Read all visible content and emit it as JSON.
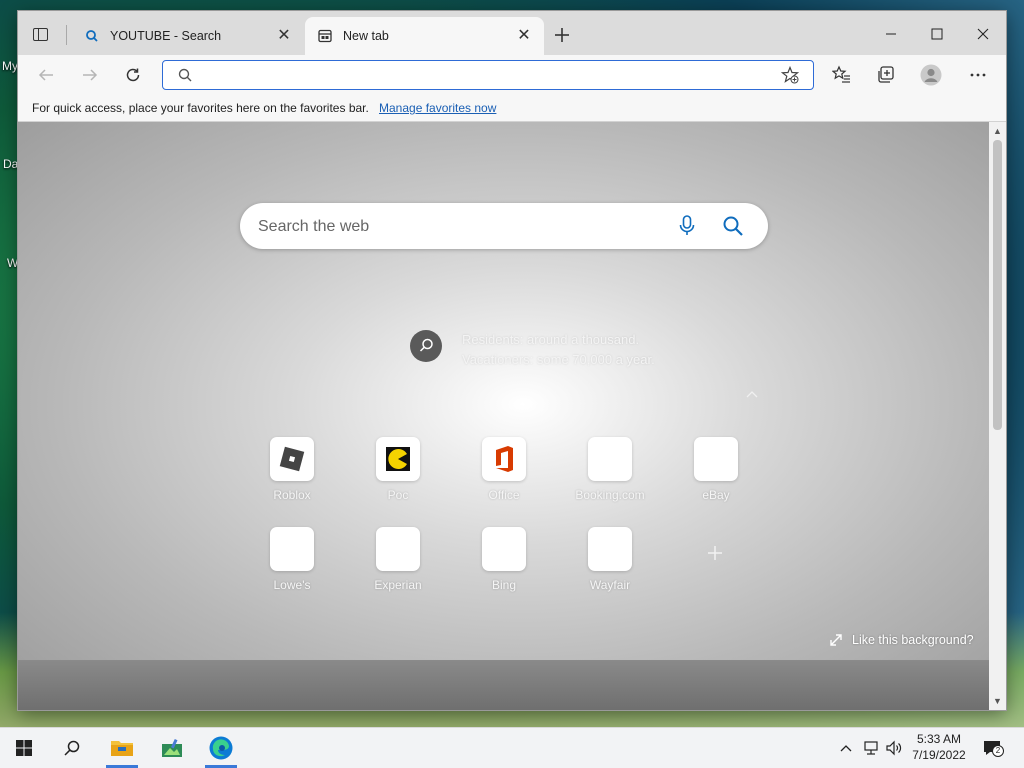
{
  "desktop": {
    "labels": [
      "My",
      "Da",
      "W"
    ]
  },
  "browser": {
    "tabs": [
      {
        "title": "YOUTUBE - Search",
        "icon": "search-icon",
        "active": false
      },
      {
        "title": "New tab",
        "icon": "newtab-page-icon",
        "active": true
      }
    ],
    "address_bar": {
      "value": "",
      "placeholder": ""
    },
    "favorites_bar": {
      "message": "For quick access, place your favorites here on the favorites bar.",
      "link": "Manage favorites now"
    }
  },
  "new_tab_page": {
    "search": {
      "placeholder": "Search the web"
    },
    "fact": {
      "line1": "Residents: around a thousand.",
      "line2": "Vacationers: some 70,000 a year."
    },
    "quick_links": [
      {
        "label": "Roblox",
        "icon": "roblox-icon"
      },
      {
        "label": "Poc",
        "icon": "pacman-icon"
      },
      {
        "label": "Office",
        "icon": "office-icon"
      },
      {
        "label": "Booking.com",
        "icon": "blank-icon"
      },
      {
        "label": "eBay",
        "icon": "blank-icon"
      },
      {
        "label": "Lowe's",
        "icon": "blank-icon"
      },
      {
        "label": "Experian",
        "icon": "blank-icon"
      },
      {
        "label": "Bing",
        "icon": "blank-icon"
      },
      {
        "label": "Wayfair",
        "icon": "blank-icon"
      }
    ],
    "like_background": "Like this background?"
  },
  "taskbar": {
    "time": "5:33 AM",
    "date": "7/19/2022",
    "notification_count": "2"
  },
  "colors": {
    "accent": "#2e6bd6",
    "search_icon": "#0f6cbd",
    "link": "#1a5fb4"
  }
}
